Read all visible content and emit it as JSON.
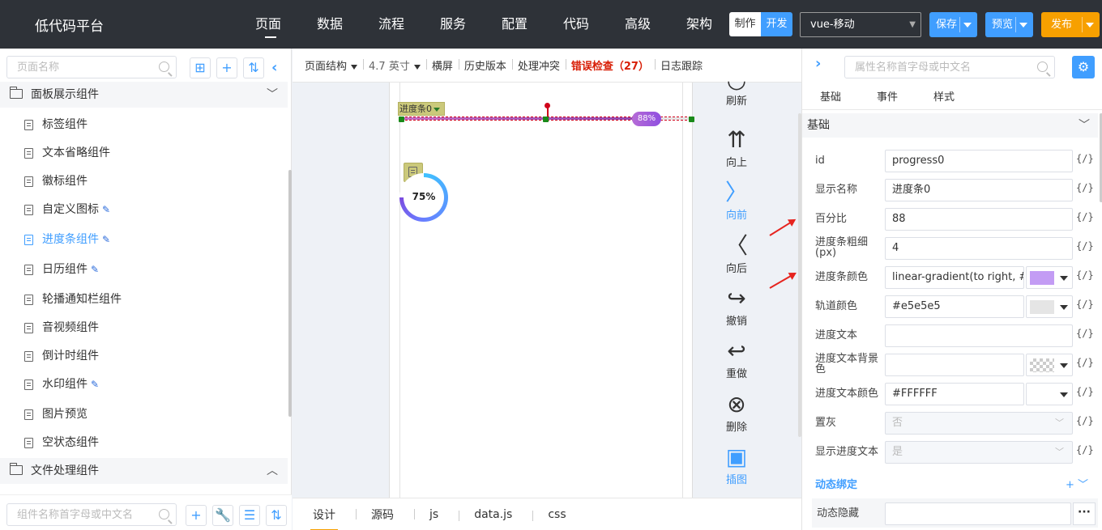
{
  "app": {
    "title": "低代码平台"
  },
  "nav": {
    "items": [
      "页面",
      "数据",
      "流程",
      "服务",
      "配置",
      "代码",
      "高级",
      "架构"
    ]
  },
  "mode": {
    "make": "制作",
    "dev": "开发"
  },
  "framework": {
    "value": "vue-移动"
  },
  "buttons": {
    "save": "保存",
    "preview": "预览",
    "publish": "发布"
  },
  "left": {
    "page_search_placeholder": "页面名称",
    "group1": "面板展示组件",
    "items": [
      "标签组件",
      "文本省略组件",
      "徽标组件",
      "自定义图标",
      "进度条组件",
      "日历组件",
      "轮播通知栏组件",
      "音视频组件",
      "倒计时组件",
      "水印组件",
      "图片预览",
      "空状态组件"
    ],
    "group2": "文件处理组件",
    "component_search_placeholder": "组件名称首字母或中文名"
  },
  "toolbar": {
    "structure": "页面结构",
    "size": "4.7 英寸",
    "landscape": "横屏",
    "history": "历史版本",
    "conflict": "处理冲突",
    "error_check": "错误检查（27）",
    "log": "日志跟踪"
  },
  "canvas": {
    "selected_tag": "进度条0",
    "progress_text": "88%",
    "progress_value": 0.88,
    "circle_text": "75%",
    "circle_value": 0.75
  },
  "actions": [
    "刷新",
    "向上",
    "向前",
    "向后",
    "撤销",
    "重做",
    "删除",
    "插图"
  ],
  "bottom_tabs": [
    "设计",
    "源码",
    "js",
    "data.js",
    "css"
  ],
  "right": {
    "search_placeholder": "属性名称首字母或中文名",
    "tabs": [
      "基础",
      "事件",
      "样式"
    ],
    "section": "基础",
    "code_icon": "{/}",
    "fields": [
      {
        "label": "id",
        "value": "progress0"
      },
      {
        "label": "显示名称",
        "value": "进度条0"
      },
      {
        "label": "百分比",
        "value": "88"
      },
      {
        "label": "进度条粗细(px)",
        "value": "4"
      },
      {
        "label": "进度条颜色",
        "value": "linear-gradient(to right, #",
        "swatch": "#c39cf4"
      },
      {
        "label": "轨道颜色",
        "value": "#e5e5e5",
        "swatch": "#e5e5e5"
      },
      {
        "label": "进度文本",
        "value": ""
      },
      {
        "label": "进度文本背景色",
        "value": ""
      },
      {
        "label": "进度文本颜色",
        "value": "#FFFFFF"
      },
      {
        "label": "置灰",
        "value": "否"
      },
      {
        "label": "显示进度文本",
        "value": "是"
      }
    ],
    "dynamic_title": "动态绑定",
    "dynamic_tools": "+ ﹀",
    "dynamic_hide": "动态隐藏",
    "dots": "···"
  },
  "colors": {
    "accent": "#409eff",
    "publish": "#f7a000",
    "error": "#d81e06",
    "topbar": "#2e3238"
  }
}
